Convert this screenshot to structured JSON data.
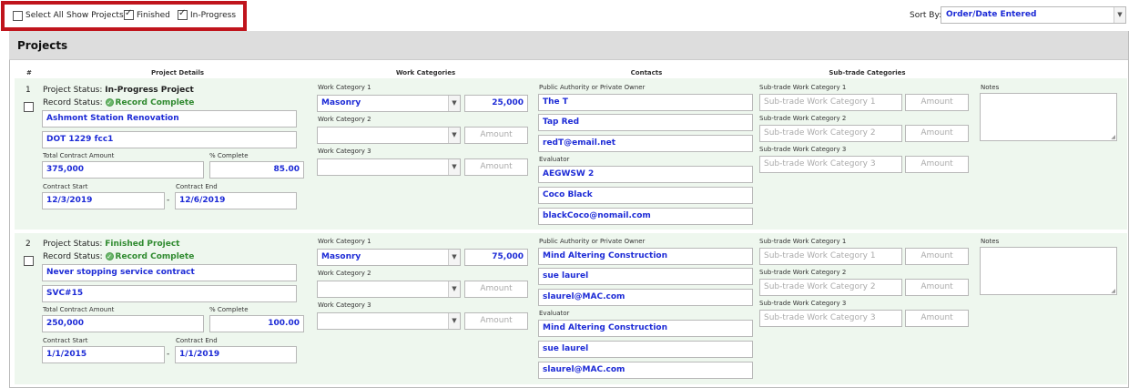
{
  "toolbar": {
    "select_all_label": "Select All",
    "show_projects_label": "Show Projects:",
    "finished_label": "Finished",
    "in_progress_label": "In-Progress",
    "sort_by_label": "Sort By:",
    "sort_by_value": "Order/Date Entered"
  },
  "panel": {
    "title": "Projects",
    "columns": {
      "num": "#",
      "details": "Project Details",
      "work": "Work Categories",
      "contacts": "Contacts",
      "subtrade": "Sub-trade Categories"
    }
  },
  "labels": {
    "project_status": "Project Status:",
    "record_status": "Record Status:",
    "total_contract_amount": "Total Contract Amount",
    "percent_complete": "% Complete",
    "contract_start": "Contract Start",
    "contract_end": "Contract End",
    "dash": "-",
    "work_category_1": "Work Category 1",
    "work_category_2": "Work Category 2",
    "work_category_3": "Work Category 3",
    "amount_placeholder": "Amount",
    "owner": "Public Authority or Private Owner",
    "evaluator": "Evaluator",
    "subtrade_1": "Sub-trade Work Category 1",
    "subtrade_2": "Sub-trade Work Category 2",
    "subtrade_3": "Sub-trade Work Category 3",
    "notes": "Notes"
  },
  "projects": [
    {
      "num": "1",
      "project_status": "In-Progress Project",
      "record_status": "Record Complete",
      "name": "Ashmont Station Renovation",
      "code": "DOT 1229 fcc1",
      "total_amount": "375,000",
      "percent_complete": "85.00",
      "start": "12/3/2019",
      "end": "12/6/2019",
      "work_category_1": "Masonry",
      "work_amount_1": "25,000",
      "owner_name": "The T",
      "owner_contact": "Tap Red",
      "owner_email": "redT@email.net",
      "evaluator_name": "AEGWSW 2",
      "evaluator_contact": "Coco Black",
      "evaluator_email": "blackCoco@nomail.com"
    },
    {
      "num": "2",
      "project_status": "Finished Project",
      "record_status": "Record Complete",
      "name": "Never stopping service contract",
      "code": "SVC#15",
      "total_amount": "250,000",
      "percent_complete": "100.00",
      "start": "1/1/2015",
      "end": "1/1/2019",
      "work_category_1": "Masonry",
      "work_amount_1": "75,000",
      "owner_name": "Mind Altering Construction",
      "owner_contact": "sue laurel",
      "owner_email": "slaurel@MAC.com",
      "evaluator_name": "Mind Altering Construction",
      "evaluator_contact": "sue laurel",
      "evaluator_email": "slaurel@MAC.com"
    }
  ],
  "colors": {
    "highlight_border": "#c0141c",
    "value_blue": "#1d2bd6",
    "status_green": "#2f8a2f",
    "row_bg": "#eef7ee"
  }
}
